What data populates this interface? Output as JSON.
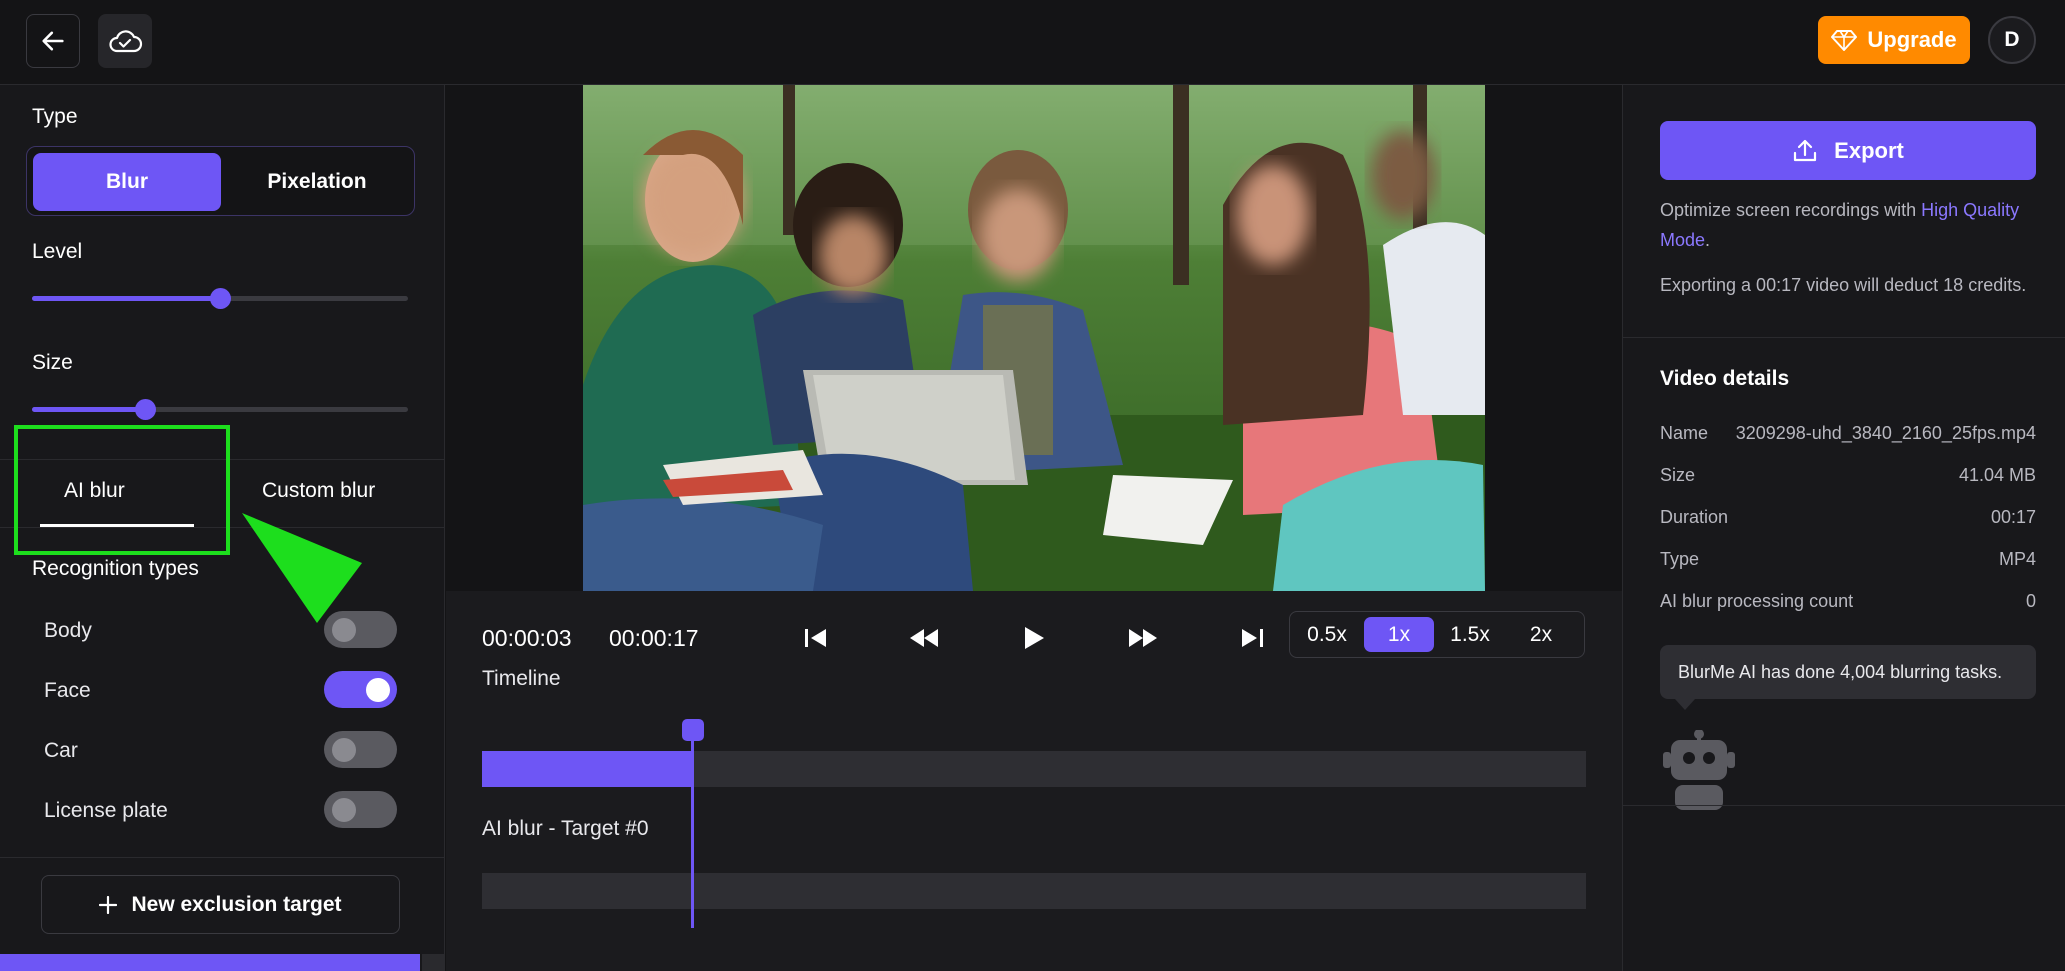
{
  "header": {
    "upgrade_label": "Upgrade",
    "avatar_initial": "D",
    "accent_color": "#ff8a00"
  },
  "left_panel": {
    "type_label": "Type",
    "type_options": [
      "Blur",
      "Pixelation"
    ],
    "type_selected": "Blur",
    "level_label": "Level",
    "level_value": 0.5,
    "size_label": "Size",
    "size_value": 0.3,
    "blur_tabs": [
      "AI blur",
      "Custom blur"
    ],
    "active_tab": "AI blur",
    "recognition_title": "Recognition types",
    "recognition_types": [
      {
        "label": "Body",
        "enabled": false
      },
      {
        "label": "Face",
        "enabled": true
      },
      {
        "label": "Car",
        "enabled": false
      },
      {
        "label": "License plate",
        "enabled": false
      }
    ],
    "new_exclusion_label": "New exclusion target"
  },
  "player": {
    "current_time": "00:00:03",
    "total_time": "00:00:17",
    "speeds": [
      "0.5x",
      "1x",
      "1.5x",
      "2x"
    ],
    "speed_selected": "1x",
    "timeline_label": "Timeline",
    "ai_track_label": "AI blur - Target #0",
    "progress": 0.19
  },
  "right_panel": {
    "export_label": "Export",
    "optimize_text": "Optimize screen recordings with ",
    "optimize_link": "High Quality Mode",
    "optimize_suffix": ".",
    "credits_text": "Exporting a 00:17 video will deduct 18 credits.",
    "details_title": "Video details",
    "details": [
      {
        "key": "Name",
        "value": "3209298-uhd_3840_2160_25fps.mp4"
      },
      {
        "key": "Size",
        "value": "41.04 MB"
      },
      {
        "key": "Duration",
        "value": "00:17"
      },
      {
        "key": "Type",
        "value": "MP4"
      },
      {
        "key": "AI blur processing count",
        "value": "0"
      }
    ],
    "tooltip_text": "BlurMe AI has done 4,004 blurring tasks.",
    "brand_color": "#6e56f5"
  }
}
